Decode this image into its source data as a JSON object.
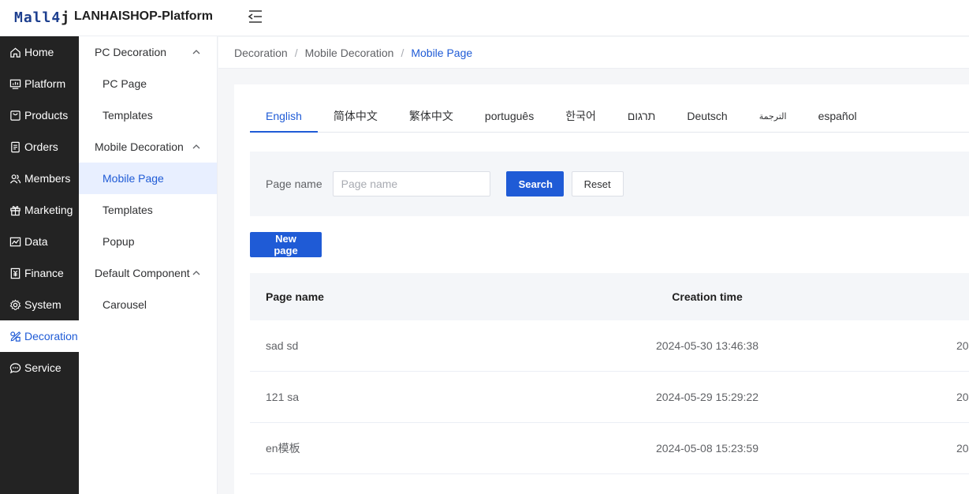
{
  "header": {
    "logo_main": "Mall4",
    "logo_j": "j",
    "title": "LANHAISHOP-Platform"
  },
  "primary_nav": [
    {
      "label": "Home",
      "icon": "home-icon"
    },
    {
      "label": "Platform",
      "icon": "monitor-icon"
    },
    {
      "label": "Products",
      "icon": "bag-icon"
    },
    {
      "label": "Orders",
      "icon": "document-icon"
    },
    {
      "label": "Members",
      "icon": "users-icon"
    },
    {
      "label": "Marketing",
      "icon": "gift-icon"
    },
    {
      "label": "Data",
      "icon": "chart-icon"
    },
    {
      "label": "Finance",
      "icon": "finance-icon"
    },
    {
      "label": "System",
      "icon": "gear-icon"
    },
    {
      "label": "Decoration",
      "icon": "decoration-icon",
      "active": true
    },
    {
      "label": "Service",
      "icon": "chat-icon"
    }
  ],
  "secondary_nav": {
    "groups": [
      {
        "label": "PC Decoration",
        "items": [
          "PC Page",
          "Templates"
        ]
      },
      {
        "label": "Mobile Decoration",
        "items": [
          "Mobile Page",
          "Templates",
          "Popup"
        ]
      },
      {
        "label": "Default Component",
        "items": [
          "Carousel"
        ]
      }
    ],
    "active_item": "Mobile Page"
  },
  "breadcrumb": {
    "items": [
      "Decoration",
      "Mobile Decoration"
    ],
    "current": "Mobile Page",
    "separator": "/"
  },
  "language_tabs": {
    "items": [
      "English",
      "简体中文",
      "繁体中文",
      "português",
      "한국어",
      "תרגום",
      "Deutsch",
      "الترجمة",
      "español"
    ],
    "active": "English"
  },
  "search": {
    "label": "Page name",
    "placeholder": "Page name",
    "value": "",
    "search_label": "Search",
    "reset_label": "Reset"
  },
  "new_page_label": "New page",
  "table": {
    "columns": {
      "name": "Page name",
      "time": "Creation time"
    },
    "rows": [
      {
        "name": "sad sd",
        "time": "2024-05-30 13:46:38",
        "extra": "20"
      },
      {
        "name": "121 sa",
        "time": "2024-05-29 15:29:22",
        "extra": "20"
      },
      {
        "name": "en模板",
        "time": "2024-05-08 15:23:59",
        "extra": "20"
      }
    ]
  },
  "colors": {
    "accent": "#1f5bd6",
    "sidebar_bg": "#232323",
    "active_bg": "#e8efff"
  }
}
